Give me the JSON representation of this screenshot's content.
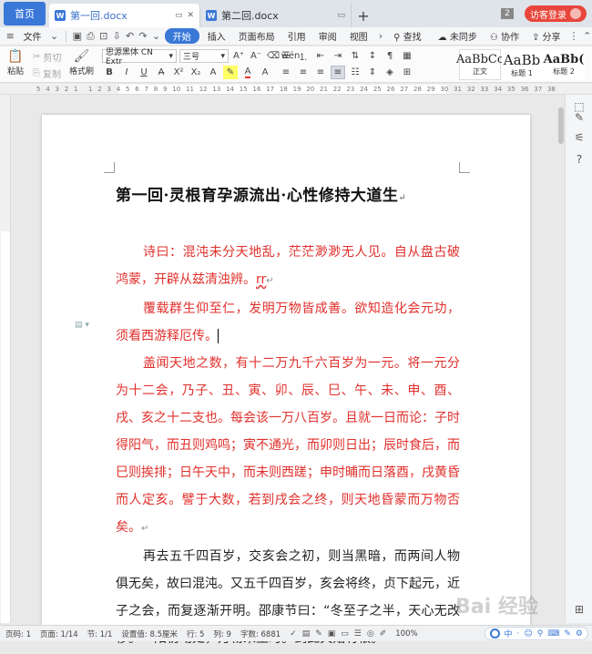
{
  "tabs": {
    "home": "首页",
    "doc1": "第一回.docx",
    "doc2": "第二回.docx",
    "count": "2",
    "login": "访客登录"
  },
  "menu": {
    "file": "文件",
    "start": "开始",
    "insert": "插入",
    "layout": "页面布局",
    "reference": "引用",
    "review": "审阅",
    "view": "视图",
    "search": "查找",
    "sync": "未同步",
    "collab": "协作",
    "share": "分享"
  },
  "ribbon": {
    "paste": "粘贴",
    "cut": "剪切",
    "copy": "复制",
    "format_painter": "格式刷",
    "font_name": "思源黑体 CN Extr",
    "font_size": "三号",
    "styles": [
      {
        "sample": "AaBbCc",
        "label": "正文"
      },
      {
        "sample": "AaBb",
        "label": "标题 1"
      },
      {
        "sample": "AaBb(",
        "label": "标题 2"
      }
    ]
  },
  "ruler": [
    "5",
    "4",
    "3",
    "2",
    "1",
    "",
    "1",
    "2",
    "3",
    "4",
    "5",
    "6",
    "7",
    "8",
    "9",
    "10",
    "11",
    "12",
    "13",
    "14",
    "15",
    "16",
    "17",
    "18",
    "19",
    "20",
    "21",
    "22",
    "23",
    "24",
    "25",
    "26",
    "27",
    "28",
    "29",
    "30",
    "31",
    "32",
    "33",
    "34",
    "35",
    "36",
    "37",
    "38"
  ],
  "document": {
    "title": "第一回·灵根育孕源流出·心性修持大道生",
    "p1": "诗曰：混沌未分天地乱，茫茫渺渺无人见。自从盘古破鸿蒙，开辟从兹清浊辨。",
    "p1_tail": "rr",
    "p2": "覆载群生仰至仁，发明万物皆成善。欲知造化会元功，须看西游释厄传。",
    "p3": "盖闻天地之数，有十二万九千六百岁为一元。将一元分为十二会，乃子、丑、寅、卯、辰、巳、午、未、申、酉、戌、亥之十二支也。每会该一万八百岁。且就一日而论：子时得阳气，而丑则鸡鸣；寅不通光，而卯则日出；辰时食后，而巳则挨排；日午天中，而未则西蹉；申时晡而日落酉，戌黄昏而人定亥。譬于大数，若到戌会之终，则天地昏蒙而万物否矣。",
    "p4": "再去五千四百岁，交亥会之初，则当黑暗，而两间人物俱无矣，故曰混沌。又五千四百岁，亥会将终，贞下起元，近子之会，而复逐渐开明。邵康节曰：“冬至子之半，天心无改移。一阳初动处，万物未生时。”到此天始有根。",
    "mark": "↵"
  },
  "status": {
    "page_num": "页码: 1",
    "pages": "页面: 1/14",
    "section": "节: 1/1",
    "setting": "设置值: 8.5厘米",
    "row": "行: 5",
    "col": "列: 9",
    "words": "字数: 6881",
    "zoom": "100%"
  },
  "ime": {
    "items": [
      "中",
      "·",
      "☺",
      "⚲",
      "⌨",
      "✎",
      "⚙"
    ]
  },
  "watermark": "Bai 经验",
  "colors": {
    "accent": "#3a78d8",
    "poem_red": "#e0302c",
    "login_red": "#e8463c"
  }
}
